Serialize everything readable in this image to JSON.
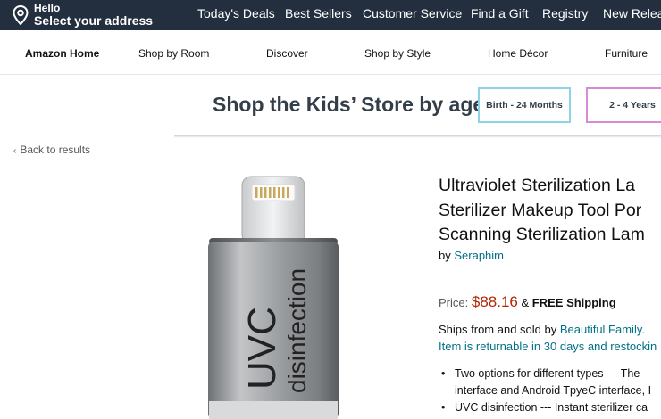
{
  "header": {
    "greeting": "Hello",
    "address_prompt": "Select your address",
    "links": [
      "Today's Deals",
      "Best Sellers",
      "Customer Service",
      "Find a Gift",
      "Registry",
      "New Releases"
    ]
  },
  "subnav": {
    "items": [
      "Amazon Home",
      "Shop by Room",
      "Discover",
      "Shop by Style",
      "Home Décor",
      "Furniture"
    ]
  },
  "banner": {
    "title": "Shop the Kids’ Store by age",
    "ages": [
      "Birth - 24 Months",
      "2 - 4 Years"
    ],
    "age_colors": [
      "#8fd3e8",
      "#d98ad6"
    ]
  },
  "back_link": "Back to results",
  "product": {
    "image_text_large": "UVC",
    "image_text_small": "disinfection",
    "title_lines": [
      "Ultraviolet Sterilization La",
      "Sterilizer Makeup Tool Por",
      "Scanning Sterilization Lam"
    ],
    "by_label": "by",
    "brand": "Seraphim",
    "price_label": "Price:",
    "price": "$88.16",
    "ampersand": "&",
    "shipping": "FREE Shipping",
    "ships_from_label": "Ships from and sold by",
    "seller": "Beautiful Family.",
    "returns": "Item is returnable in 30 days and restockin",
    "bullets": [
      "Two options for different types --- The",
      "interface and Android TpyeC interface, I",
      "UVC disinfection --- Instant sterilizer ca"
    ]
  },
  "colors": {
    "nav_bg": "#232f3e",
    "link": "#007185",
    "price": "#b12704"
  }
}
